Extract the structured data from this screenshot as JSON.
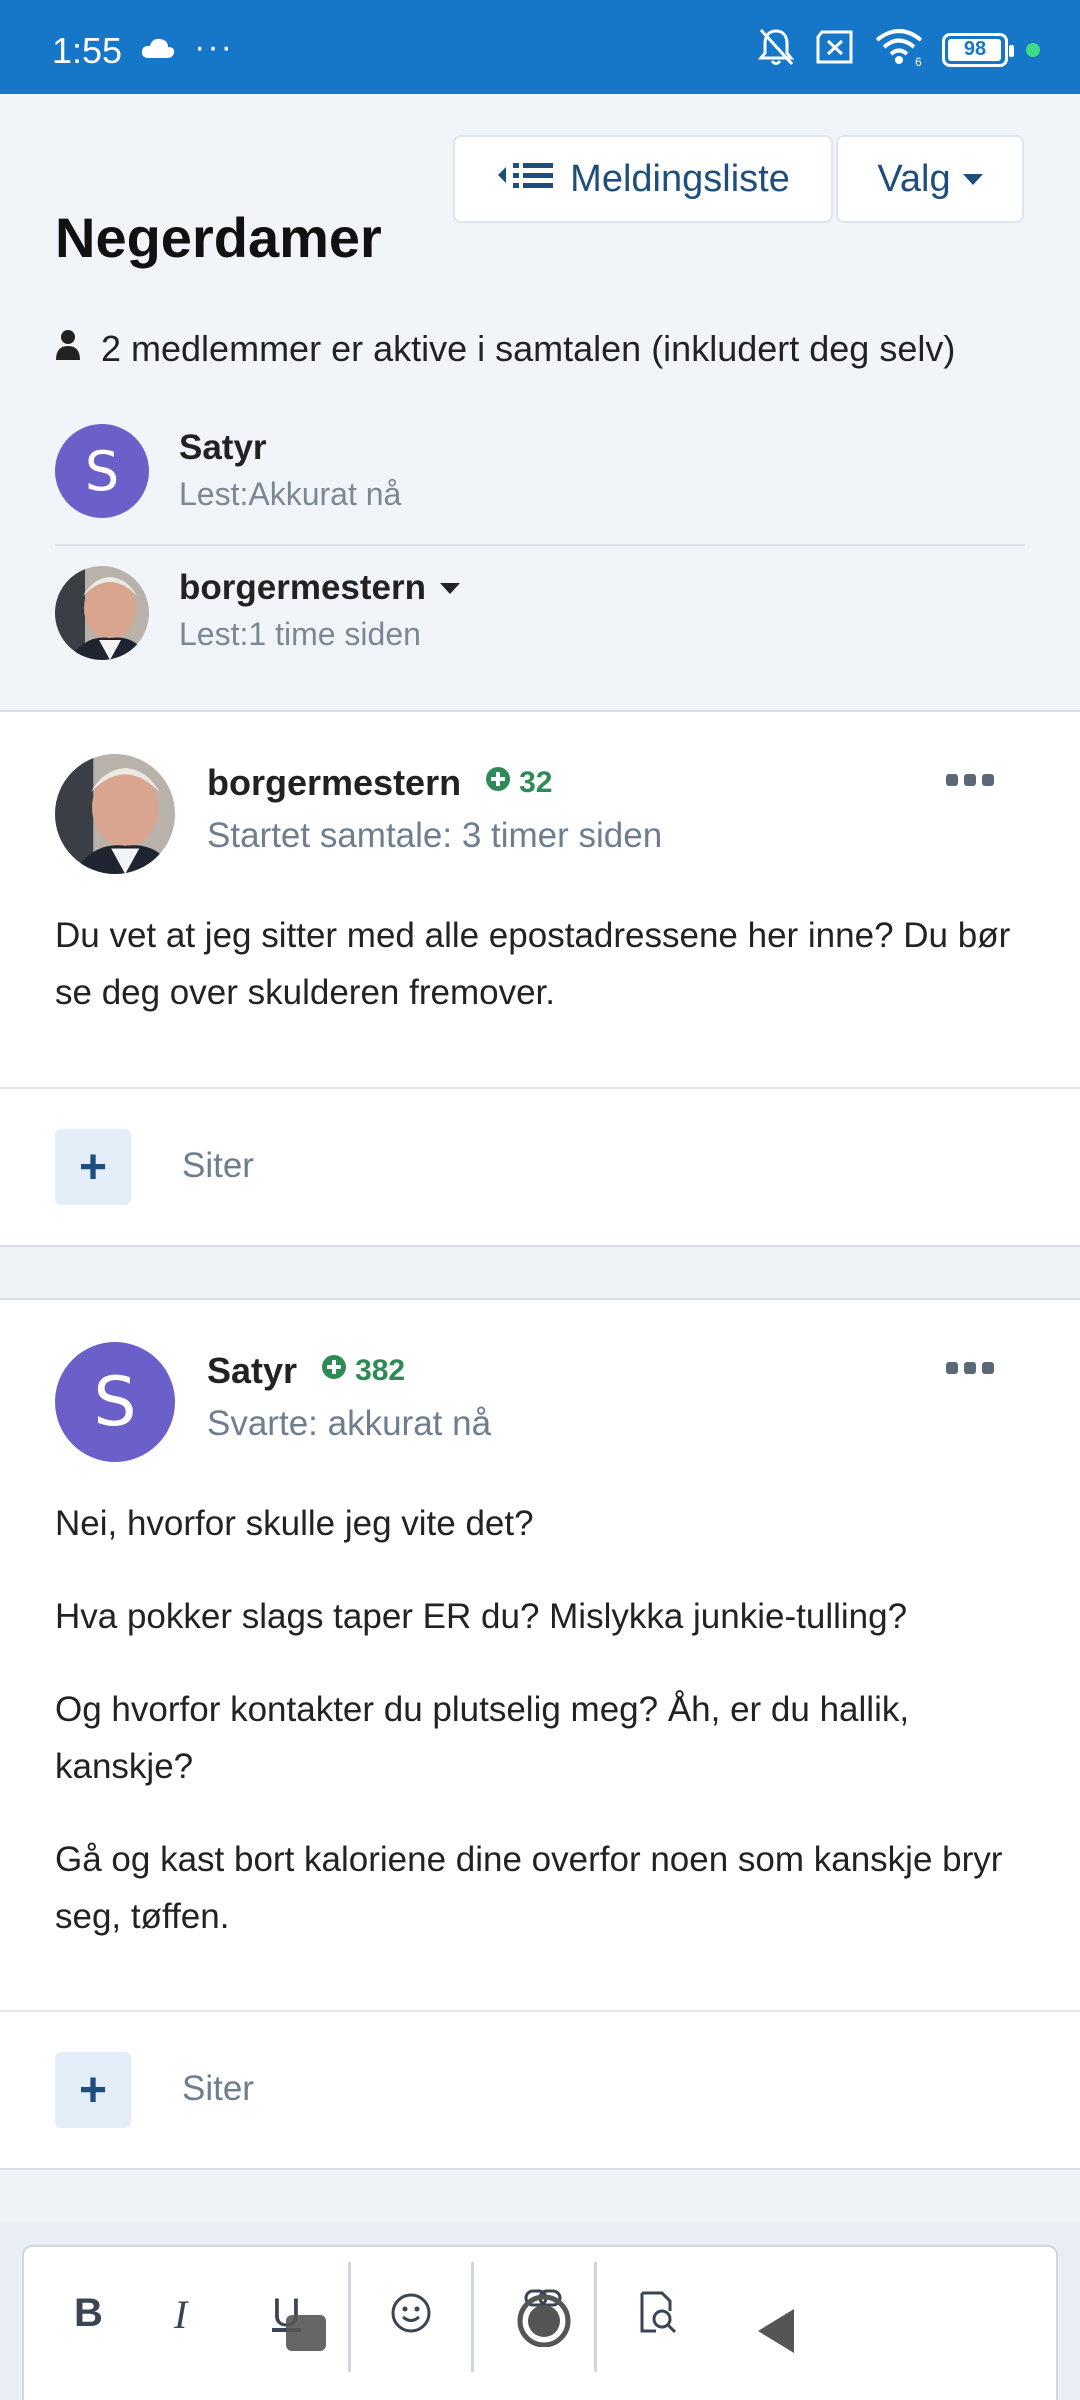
{
  "status_bar": {
    "time": "1:55",
    "battery": "98",
    "battery_level": 0.98,
    "wifi_label": "6"
  },
  "header": {
    "message_list_label": "Meldingsliste",
    "options_label": "Valg",
    "title": "Negerdamer",
    "active_members_text": "2 medlemmer er aktive i samtalen (inkludert deg selv)"
  },
  "members": [
    {
      "name": "Satyr",
      "read": "Lest:Akkurat nå",
      "avatar_letter": "S"
    },
    {
      "name": "borgermestern",
      "read": "Lest:1 time siden"
    }
  ],
  "messages": [
    {
      "author": "borgermestern",
      "reputation": "32",
      "meta": "Startet samtale: 3 timer siden",
      "paragraphs": [
        "Du vet at jeg sitter med alle epostadressene her inne? Du bør se deg over skulderen fremover."
      ],
      "quote_label": "Siter"
    },
    {
      "author": "Satyr",
      "avatar_letter": "S",
      "reputation": "382",
      "meta": "Svarte: akkurat nå",
      "paragraphs": [
        "Nei, hvorfor skulle jeg vite det?",
        "Hva pokker slags taper ER du? Mislykka junkie-tulling?",
        "Og hvorfor kontakter du plutselig meg? Åh, er du hallik, kanskje?",
        "Gå og kast bort kaloriene dine overfor noen som kanskje bryr seg, tøffen."
      ],
      "quote_label": "Siter"
    }
  ],
  "editor_toolbar": {
    "bold": "B",
    "italic": "I",
    "underline": "U"
  },
  "colors": {
    "status_bar": "#1677c9",
    "accent": "#1d4e7e",
    "avatar_purple": "#6b5fc9",
    "reputation_green": "#2e8b57"
  }
}
